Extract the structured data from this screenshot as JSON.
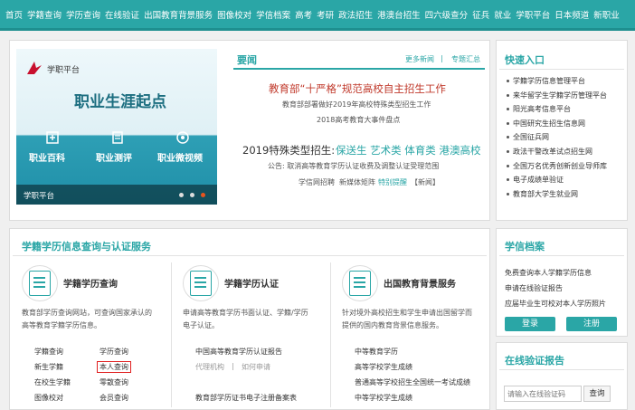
{
  "nav": [
    "首页",
    "学籍查询",
    "学历查询",
    "在线验证",
    "出国教育背景服务",
    "图像校对",
    "学信档案",
    "高考",
    "考研",
    "政法招生",
    "港澳台招生",
    "四六级查分",
    "征兵",
    "就业",
    "学职平台",
    "日本频道",
    "新职业"
  ],
  "banner": {
    "logo_text": "学职平台",
    "headline": "职业生涯起点",
    "items": [
      "职业百科",
      "职业测评",
      "职业微视频"
    ],
    "footer_text": "学职平台"
  },
  "news": {
    "title": "要闻",
    "more": "更多新闻",
    "sep": "|",
    "topics": "专题汇总",
    "headline1": "教育部“十严格”规范高校自主招生工作",
    "line1": "教育部部署做好2019年高校特殊类型招生工作",
    "line2": "2018高考教育大事件盘点",
    "headline2_prefix": "2019特殊类型招生:",
    "headline2_links": "保送生 艺术类 体育类 港澳高校",
    "line3": "公告: 取消高等教育学历认证收费及调整认证受理范围",
    "bottom_a": "学信网招聘",
    "bottom_b": "新媒体矩阵",
    "bottom_c": "特别提醒",
    "bottom_d": "【新闻】"
  },
  "quick": {
    "title": "快速入口",
    "items": [
      "学籍学历信息管理平台",
      "来华留学生学籍学历管理平台",
      "阳光高考信息平台",
      "中国研究生招生信息网",
      "全国征兵网",
      "政法干警改革试点招生网",
      "全国万名优秀创新创业导师库",
      "电子成绩单验证",
      "教育部大学生就业网"
    ]
  },
  "service": {
    "title": "学籍学历信息查询与认证服务",
    "col1": {
      "title": "学籍学历查询",
      "desc1": "教育部学历查询网站，可查询国家承认的",
      "desc2": "高等教育学籍学历信息。",
      "links": [
        [
          "学籍查询",
          "学历查询"
        ],
        [
          "新生学籍",
          "本人查询"
        ],
        [
          "在校生学籍",
          "零散查询"
        ],
        [
          "图像校对",
          "会员查询"
        ]
      ]
    },
    "col2": {
      "title": "学籍学历认证",
      "desc1": "申请高等教育学历书面认证、学籍/学历",
      "desc2": "电子认证。",
      "link1": "中国高等教育学历认证报告",
      "link2": "代理机构",
      "sep": "|",
      "link3": "如何申请",
      "link4": "教育部学历证书电子注册备案表"
    },
    "col3": {
      "title": "出国教育背景服务",
      "desc1": "针对境外高校招生和学生申请出国留学而",
      "desc2": "提供的国内教育背景信息服务。",
      "links": [
        "中等教育学历",
        "高等学校学生成绩",
        "普通高等学校招生全国统一考试成绩",
        "中等学校学生成绩"
      ]
    }
  },
  "archive": {
    "title": "学信档案",
    "items": [
      "免费查询本人学籍学历信息",
      "申请在线验证报告",
      "应届毕业生可校对本人学历照片"
    ],
    "login": "登录",
    "register": "注册"
  },
  "verify": {
    "title": "在线验证报告",
    "placeholder": "请输入在线验证码",
    "button": "查询"
  }
}
